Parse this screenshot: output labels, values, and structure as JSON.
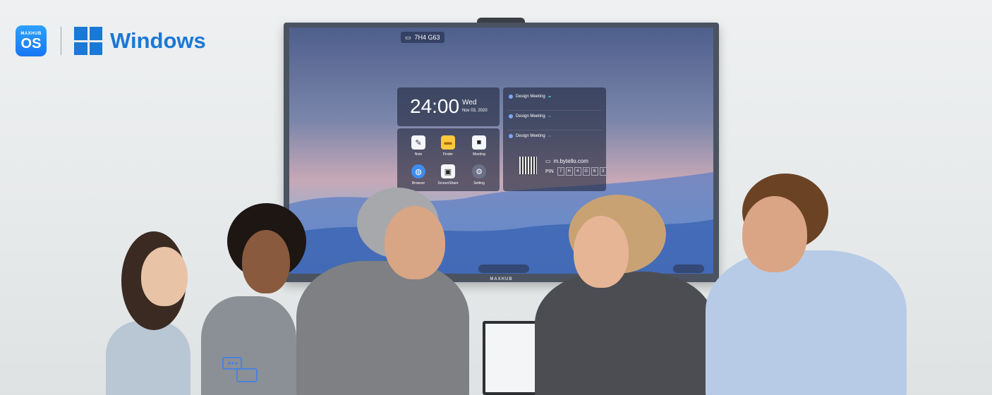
{
  "brand": {
    "os_badge_top": "MAXHUB",
    "os_badge_main": "OS",
    "windows_label": "Windows"
  },
  "monitor": {
    "bezel_label": "MAXHUB"
  },
  "screen": {
    "room_code": "7H4 G63",
    "clock": {
      "time": "24:00",
      "day": "Wed",
      "date": "Nov 03, 2020"
    },
    "apps": [
      {
        "label": "Note",
        "icon": "pen-icon",
        "color": "#f4f6fb"
      },
      {
        "label": "Finder",
        "icon": "folder-icon",
        "color": "#ffc83d"
      },
      {
        "label": "Meeting",
        "icon": "video-icon",
        "color": "#f4f6fb"
      },
      {
        "label": "Browser",
        "icon": "globe-icon",
        "color": "#3b8ef0"
      },
      {
        "label": "ScreenShare",
        "icon": "screen-share-icon",
        "color": "#f4f6fb"
      },
      {
        "label": "Setting",
        "icon": "gear-icon",
        "color": "#6a7088"
      }
    ],
    "meetings": [
      {
        "title": "Design Meeting",
        "tag": "",
        "sub": ""
      },
      {
        "title": "Design Meeting",
        "tag": "",
        "sub": ""
      },
      {
        "title": "Design Meeting",
        "tag": "",
        "sub": ""
      }
    ],
    "share_url": "m.bytello.com",
    "pin_label": "PIN",
    "pin_digits": [
      "7",
      "H",
      "4",
      "G",
      "6",
      "3"
    ]
  }
}
